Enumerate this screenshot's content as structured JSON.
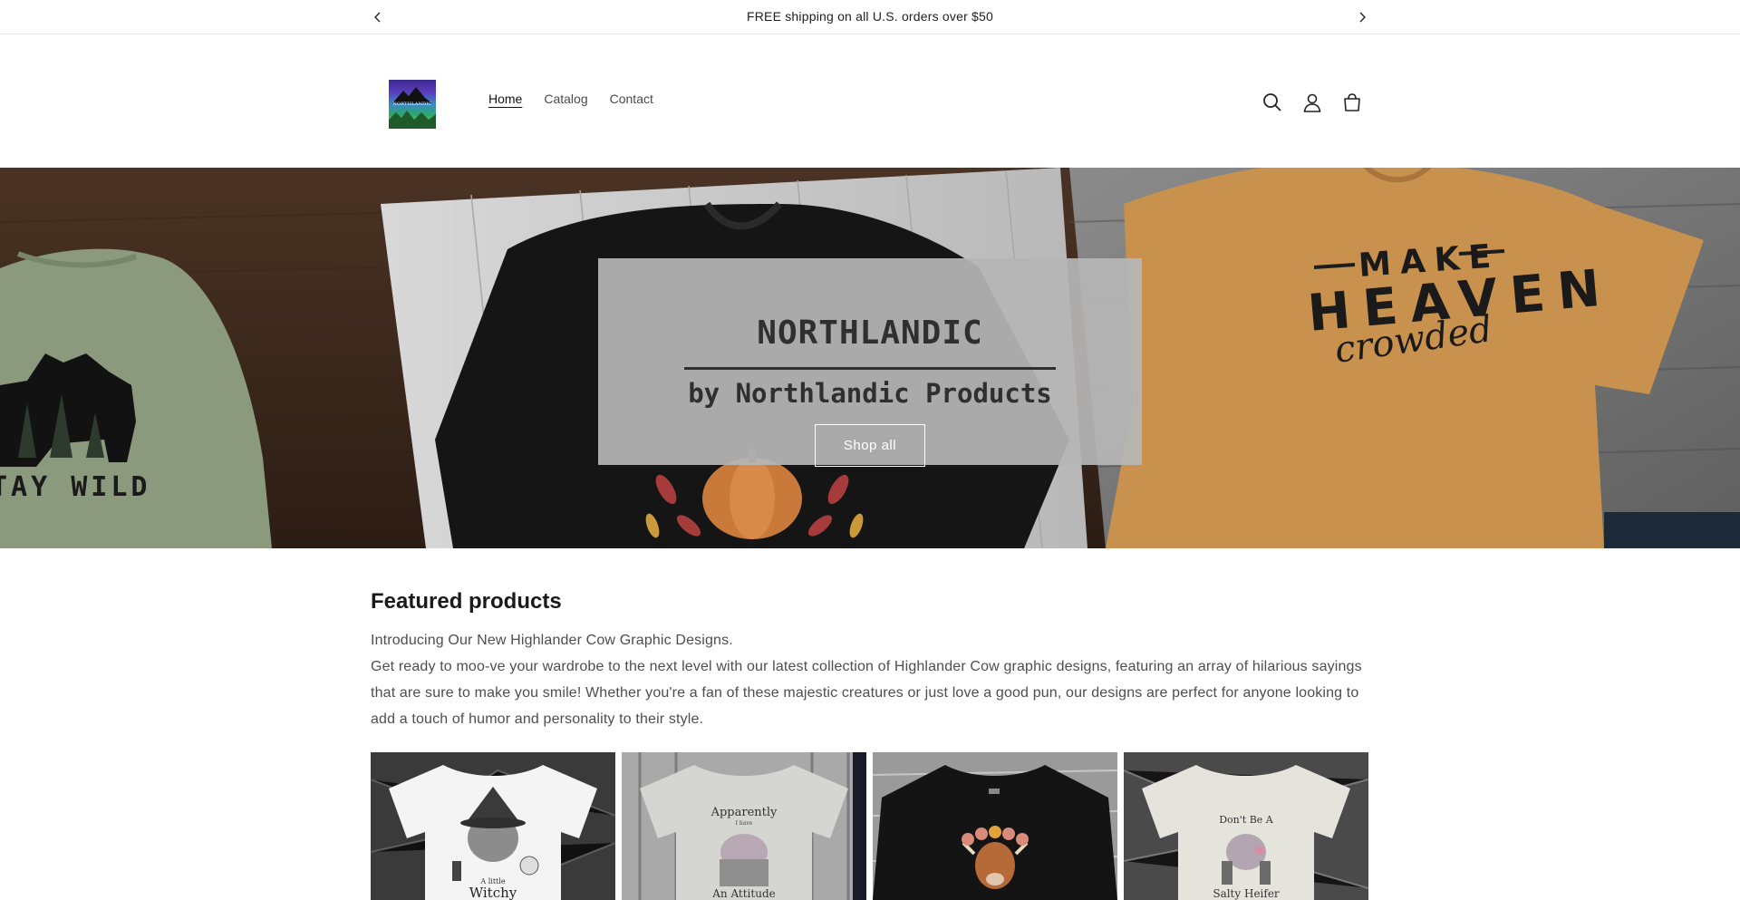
{
  "announcement": {
    "text": "FREE shipping on all U.S. orders over $50"
  },
  "header": {
    "logo_text": "NORTHLANDIC",
    "nav": [
      {
        "label": "Home",
        "active": true
      },
      {
        "label": "Catalog",
        "active": false
      },
      {
        "label": "Contact",
        "active": false
      }
    ],
    "icons": [
      "search-icon",
      "account-icon",
      "cart-icon"
    ]
  },
  "hero": {
    "title": "NORTHLANDIC",
    "subtitle": "by Northlandic Products",
    "button_label": "Shop all",
    "shirt_texts": {
      "left": "TAY WILD",
      "right_top": "MAKE",
      "right_mid": "HEAVEN",
      "right_script": "crowded"
    }
  },
  "featured": {
    "title": "Featured products",
    "line1": "Introducing Our New Highlander Cow Graphic Designs.",
    "line2": "Get ready to moo-ve your wardrobe to the next level with our latest collection of Highlander Cow graphic designs, featuring an array of hilarious sayings that are sure to make you smile! Whether you're a fan of these majestic creatures or just love a good pun, our designs are perfect for anyone looking to add a touch of humor and personality to their style."
  },
  "products": [
    {
      "top_text": "",
      "bottom_text": "Witchy",
      "small_text": "A little"
    },
    {
      "top_text": "Apparently",
      "bottom_text": "An Attitude",
      "small_text": "I have"
    },
    {
      "top_text": "",
      "bottom_text": "",
      "small_text": ""
    },
    {
      "top_text": "Don't Be A",
      "bottom_text": "Salty Heifer",
      "small_text": ""
    }
  ],
  "colors": {
    "accent_text": "#121212",
    "hero_box": "#b6b6b6",
    "muted_text": "#4e4e4e"
  }
}
